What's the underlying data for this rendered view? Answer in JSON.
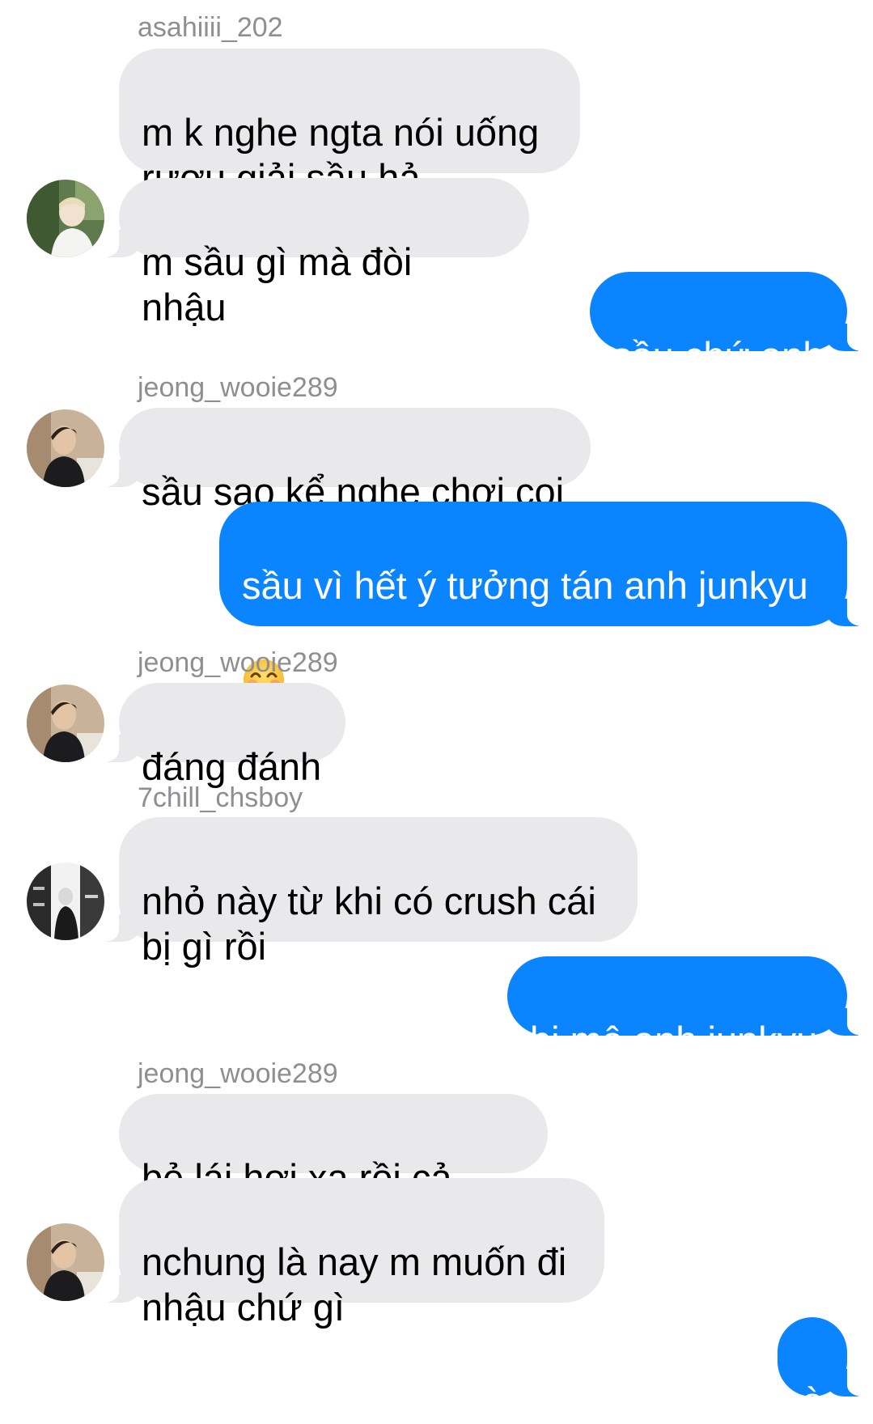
{
  "conversation": {
    "senders": {
      "s1": "asahiiii_202",
      "s2": "jeong_wooie289",
      "s3": "jeong_wooie289",
      "s4": "7chill_chsboy",
      "s5": "jeong_wooie289"
    },
    "messages": [
      {
        "direction": "incoming",
        "text": "m k nghe ngta nói uống\nrượu giải sầu hả"
      },
      {
        "direction": "incoming",
        "text": "m sầu gì mà đòi nhậu"
      },
      {
        "direction": "outgoing",
        "text": "sầu chứ anh"
      },
      {
        "direction": "incoming",
        "text": "sầu sao kể nghe chơi coi"
      },
      {
        "direction": "outgoing",
        "text": "sầu vì hết ý tưởng tán anh junkyu",
        "emoji": "smiling-face-with-smiling-eyes"
      },
      {
        "direction": "incoming",
        "text": "đáng đánh"
      },
      {
        "direction": "incoming",
        "text": "nhỏ này từ khi có crush cái\nbị gì rồi"
      },
      {
        "direction": "outgoing",
        "text": "bị mê anh junkyu"
      },
      {
        "direction": "incoming",
        "text": "bẻ lái hơi xa rồi cả nhà"
      },
      {
        "direction": "incoming",
        "text": "nchung là nay m muốn đi\nnhậu chứ gì"
      },
      {
        "direction": "outgoing",
        "text": "ò"
      }
    ]
  },
  "theme": {
    "incoming_bubble": "#e9e9eb",
    "outgoing_bubble": "#0a84ff",
    "sender_label": "#8e8e93",
    "background": "#ffffff"
  },
  "icons": {
    "avatars": [
      "avatar-photo-icon"
    ],
    "emoji": "smiling-face-with-smiling-eyes"
  }
}
